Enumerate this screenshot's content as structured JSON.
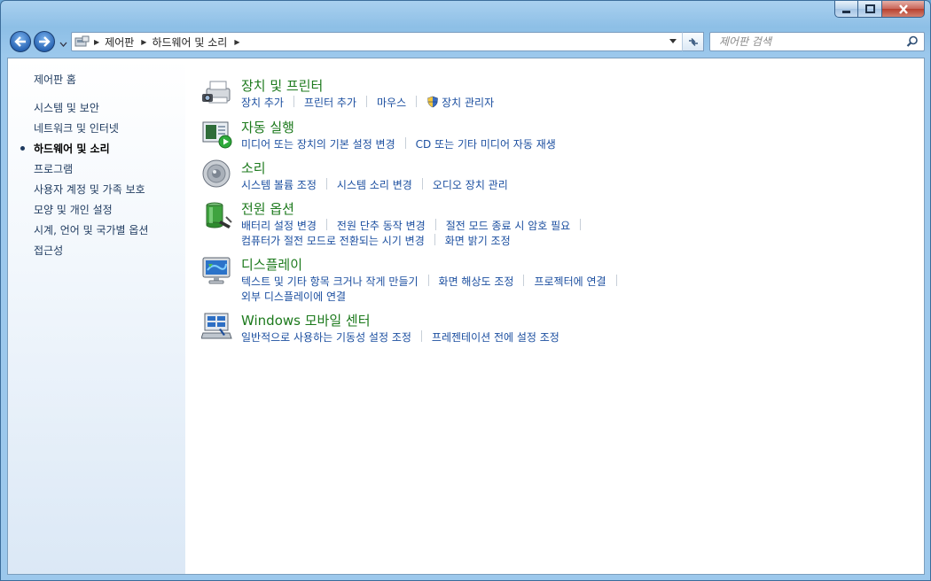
{
  "address": {
    "crumbs": [
      "제어판",
      "하드웨어 및 소리"
    ]
  },
  "search": {
    "placeholder": "제어판 검색"
  },
  "sidebar": {
    "home": "제어판 홈",
    "items": [
      {
        "label": "시스템 및 보안",
        "active": false
      },
      {
        "label": "네트워크 및 인터넷",
        "active": false
      },
      {
        "label": "하드웨어 및 소리",
        "active": true
      },
      {
        "label": "프로그램",
        "active": false
      },
      {
        "label": "사용자 계정 및 가족 보호",
        "active": false
      },
      {
        "label": "모양 및 개인 설정",
        "active": false
      },
      {
        "label": "시계, 언어 및 국가별 옵션",
        "active": false
      },
      {
        "label": "접근성",
        "active": false
      }
    ]
  },
  "categories": [
    {
      "title": "장치 및 프린터",
      "icon": "printer-camera-icon",
      "rows": [
        [
          "장치 추가",
          "프린터 추가",
          "마우스",
          "장치 관리자"
        ]
      ]
    },
    {
      "title": "자동 실행",
      "icon": "autoplay-icon",
      "rows": [
        [
          "미디어 또는 장치의 기본 설정 변경",
          "CD 또는 기타 미디어 자동 재생"
        ]
      ]
    },
    {
      "title": "소리",
      "icon": "speaker-icon",
      "rows": [
        [
          "시스템 볼륨 조정",
          "시스템 소리 변경",
          "오디오 장치 관리"
        ]
      ]
    },
    {
      "title": "전원 옵션",
      "icon": "battery-icon",
      "rows": [
        [
          "배터리 설정 변경",
          "전원 단추 동작 변경",
          "절전 모드 종료 시 암호 필요"
        ],
        [
          "컴퓨터가 절전 모드로 전환되는 시기 변경",
          "화면 밝기 조정"
        ]
      ]
    },
    {
      "title": "디스플레이",
      "icon": "monitor-icon",
      "rows": [
        [
          "텍스트 및 기타 항목 크거나 작게 만들기",
          "화면 해상도 조정",
          "프로젝터에 연결"
        ],
        [
          "외부 디스플레이에 연결"
        ]
      ]
    },
    {
      "title": "Windows 모바일 센터",
      "icon": "mobility-center-icon",
      "rows": [
        [
          "일반적으로 사용하는 기동성 설정 조정",
          "프레젠테이션 전에 설정 조정"
        ]
      ]
    }
  ],
  "colors": {
    "category_title": "#1d7a1d",
    "link": "#1c4fa0"
  }
}
